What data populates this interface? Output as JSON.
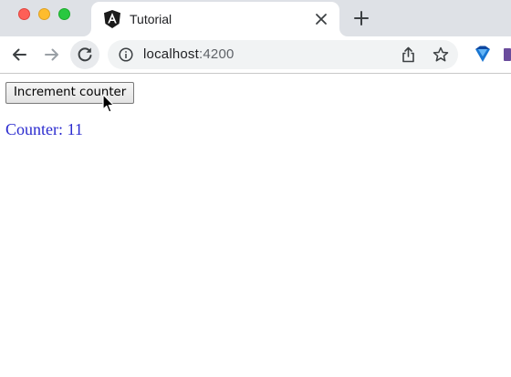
{
  "browser": {
    "tab": {
      "title": "Tutorial",
      "favicon": "angular-logo-icon"
    },
    "address_bar": {
      "host": "localhost",
      "port": ":4200"
    },
    "colors": {
      "tabstrip_bg": "#dee1e6",
      "omnibox_bg": "#f1f3f4"
    }
  },
  "page": {
    "button_label": "Increment counter",
    "counter_text": "Counter: 11",
    "counter_color": "#2b2bcf"
  }
}
